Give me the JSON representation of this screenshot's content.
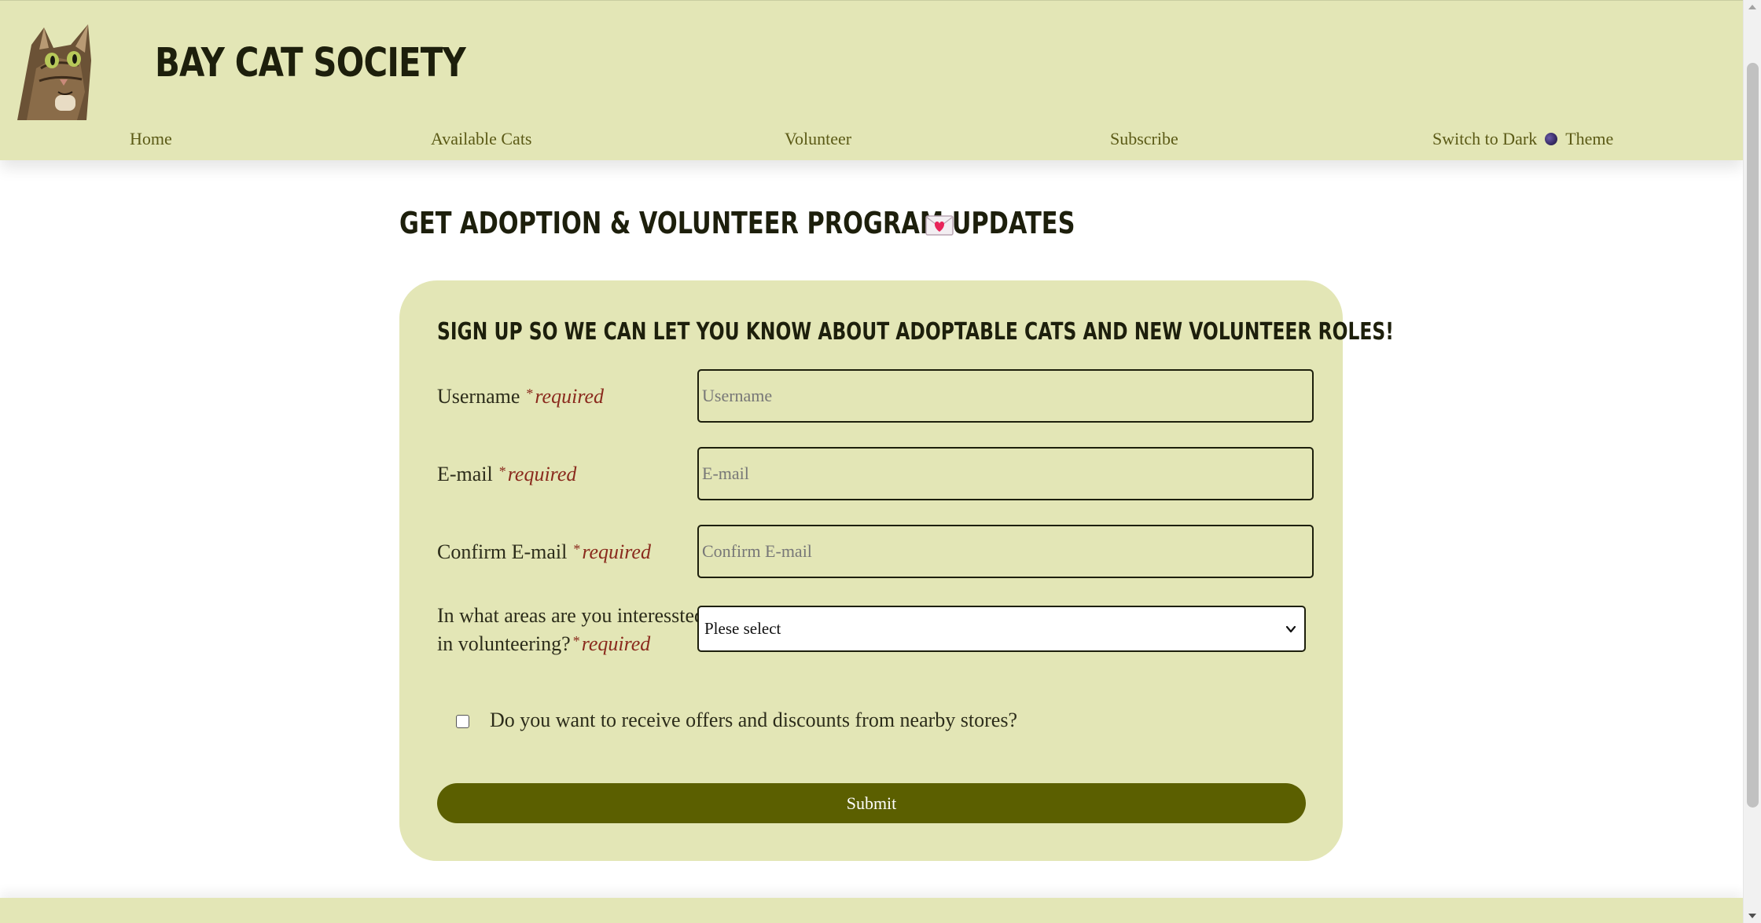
{
  "header": {
    "site_title": "BAY CAT SOCIETY",
    "logo_icon": "cat-photo",
    "nav": [
      {
        "label": "Home"
      },
      {
        "label": "Available Cats"
      },
      {
        "label": "Volunteer"
      },
      {
        "label": "Subscribe"
      }
    ],
    "theme_switch": {
      "prefix": "Switch to Dark",
      "icon": "moon-icon",
      "suffix": "Theme"
    }
  },
  "main": {
    "heading": "GET ADOPTION & VOLUNTEER PROGRAM UPDATES",
    "heading_icon": "love-letter-icon",
    "form": {
      "subheading": "SIGN UP SO WE CAN LET YOU KNOW ABOUT ADOPTABLE CATS AND NEW VOLUNTEER ROLES!",
      "required_text": "required",
      "required_star": "*",
      "username": {
        "label": "Username",
        "placeholder": "Username",
        "value": ""
      },
      "email": {
        "label": "E-mail",
        "placeholder": "E-mail",
        "value": ""
      },
      "confirm_email": {
        "label": "Confirm E-mail",
        "placeholder": "Confirm E-mail",
        "value": ""
      },
      "volunteer_areas": {
        "label_line1": "In what areas are you interessted",
        "label_line2": "in volunteering?",
        "selected": "Plese select"
      },
      "offers_checkbox": {
        "label": "Do you want to receive offers and discounts from nearby stores?",
        "checked": false
      },
      "submit_label": "Submit"
    }
  },
  "colors": {
    "header_bg": "#e3e6b6",
    "card_bg": "#e3e6b6",
    "nav_text": "#5b5a16",
    "required": "#8a2a1d",
    "button_bg": "#5b5f00",
    "title_text": "#1d1f0c"
  }
}
